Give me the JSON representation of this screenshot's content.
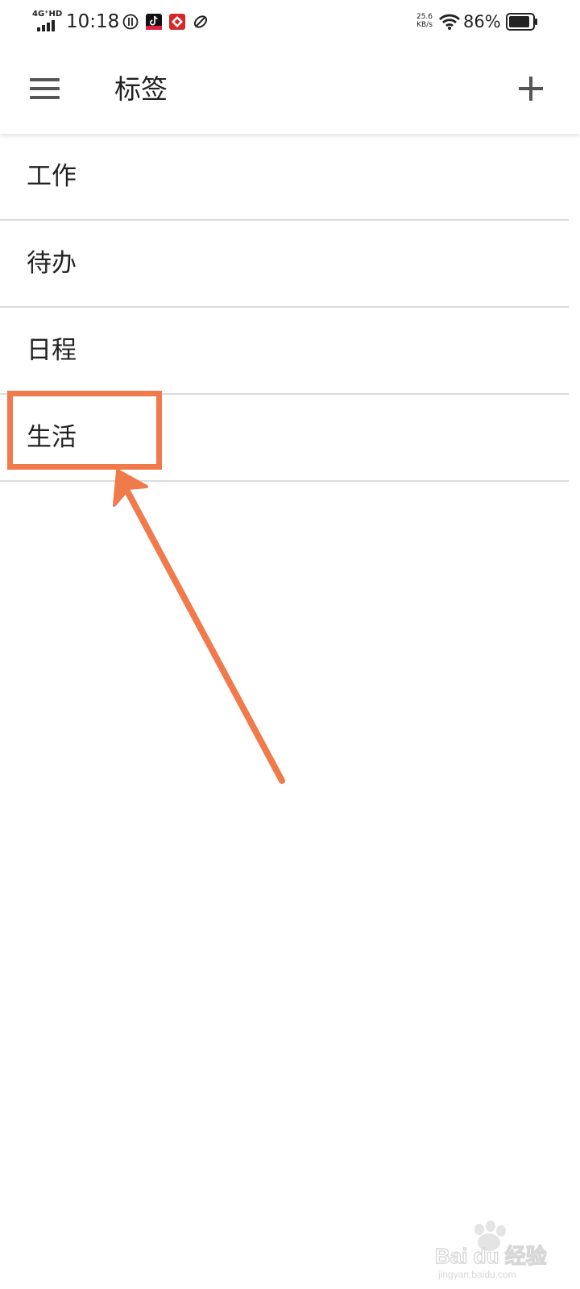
{
  "status_bar": {
    "network": "4G⁺HD",
    "time": "10:18",
    "speed_value": "25.6",
    "speed_unit": "KB/s",
    "battery": "86%"
  },
  "app_bar": {
    "menu_icon": "menu-icon",
    "title": "标签",
    "add_icon": "plus-icon"
  },
  "tags": [
    {
      "label": "工作"
    },
    {
      "label": "待办"
    },
    {
      "label": "日程"
    },
    {
      "label": "生活"
    }
  ],
  "annotation": {
    "color": "#f07a4c",
    "highlighted_tag": "生活"
  },
  "watermark": {
    "text": "Bai du 经验",
    "url": "jingyan.baidu.com"
  }
}
